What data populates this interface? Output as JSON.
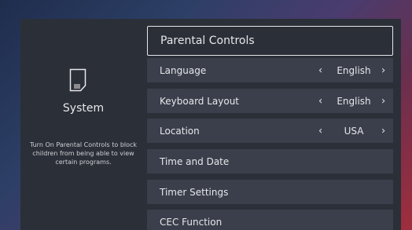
{
  "left_pane": {
    "icon": "sd-card-icon",
    "title": "System",
    "description": "Turn On Parental Controls to block children from being able to view certain programs."
  },
  "menu": {
    "items": [
      {
        "label": "Parental Controls"
      },
      {
        "label": "Language",
        "value": "English",
        "prev_glyph": "‹",
        "next_glyph": "›"
      },
      {
        "label": "Keyboard Layout",
        "value": "English",
        "prev_glyph": "‹",
        "next_glyph": "›"
      },
      {
        "label": "Location",
        "value": "USA",
        "prev_glyph": "‹",
        "next_glyph": "›"
      },
      {
        "label": "Time and Date"
      },
      {
        "label": "Timer Settings"
      },
      {
        "label": "CEC Function"
      }
    ]
  },
  "colors": {
    "panel_bg": "#2b2f38",
    "item_bg": "#3a3f4b",
    "text": "#e6e7ea",
    "selected_border": "#e6e7ea"
  }
}
